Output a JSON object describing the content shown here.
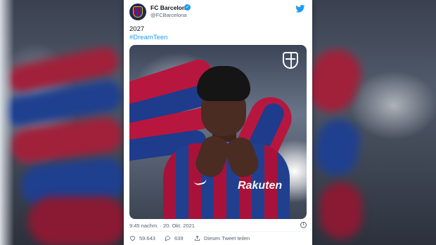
{
  "tweet": {
    "account_name": "FC Barcelona",
    "handle": "@FCBarcelona",
    "text_line1": "2027",
    "hashtag": "#DreamTeen",
    "timestamp": "9:45 nachm. · 20. Okt. 2021",
    "media_sponsor": "Rakuten",
    "icons": [
      "verified-badge",
      "twitter-bird",
      "fcb-crest",
      "info",
      "heart",
      "reply"
    ]
  },
  "actions": {
    "likes": "59.643",
    "replies": "639",
    "share_label": "Diesen Tweet teilen"
  },
  "colors": {
    "link": "#1d9bf0",
    "text": "#0f1419",
    "secondary": "#536471",
    "blaugrana_red": "#a50044",
    "blaugrana_blue": "#1e3c8c"
  }
}
